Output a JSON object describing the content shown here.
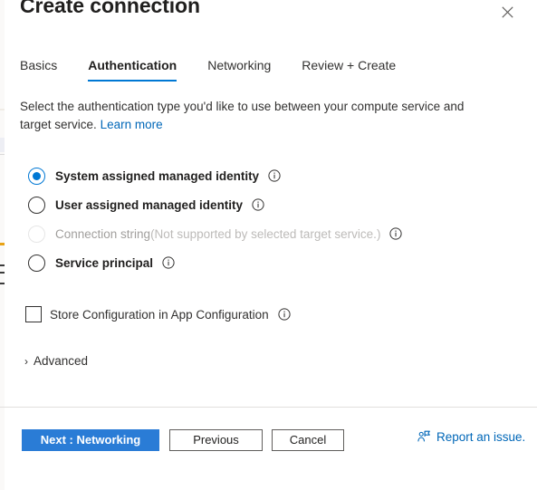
{
  "window": {
    "title": "Create connection",
    "close_label": "Close",
    "close_icon": "close-icon"
  },
  "tabs": [
    {
      "label": "Basics",
      "selected": false
    },
    {
      "label": "Authentication",
      "selected": true
    },
    {
      "label": "Networking",
      "selected": false
    },
    {
      "label": "Review + Create",
      "selected": false
    }
  ],
  "description": {
    "text": "Select the authentication type you'd like to use between your compute service and target service.",
    "link_label": "Learn more"
  },
  "auth_options": [
    {
      "label": "System assigned managed identity",
      "suffix": "",
      "selected": true,
      "disabled": false,
      "info_icon": "info-icon"
    },
    {
      "label": "User assigned managed identity",
      "suffix": "",
      "selected": false,
      "disabled": false,
      "info_icon": "info-icon"
    },
    {
      "label": "Connection string",
      "suffix": "(Not supported by selected target service.)",
      "selected": false,
      "disabled": true,
      "info_icon": "info-icon"
    },
    {
      "label": "Service principal",
      "suffix": "",
      "selected": false,
      "disabled": false,
      "info_icon": "info-icon"
    }
  ],
  "store_config": {
    "label": "Store Configuration in App Configuration",
    "checked": false,
    "info_icon": "info-icon"
  },
  "advanced": {
    "label": "Advanced",
    "chevron": "›",
    "expanded": false
  },
  "footer": {
    "next_label": "Next : Networking",
    "previous_label": "Previous",
    "cancel_label": "Cancel",
    "report_label": "Report an issue.",
    "report_icon": "report-person-icon"
  },
  "colors": {
    "accent": "#0078d4",
    "primary_button": "#2a7cd6",
    "link": "#0067b8",
    "text": "#323130",
    "disabled_text": "#a19f9d",
    "divider": "#e1dfdd"
  }
}
